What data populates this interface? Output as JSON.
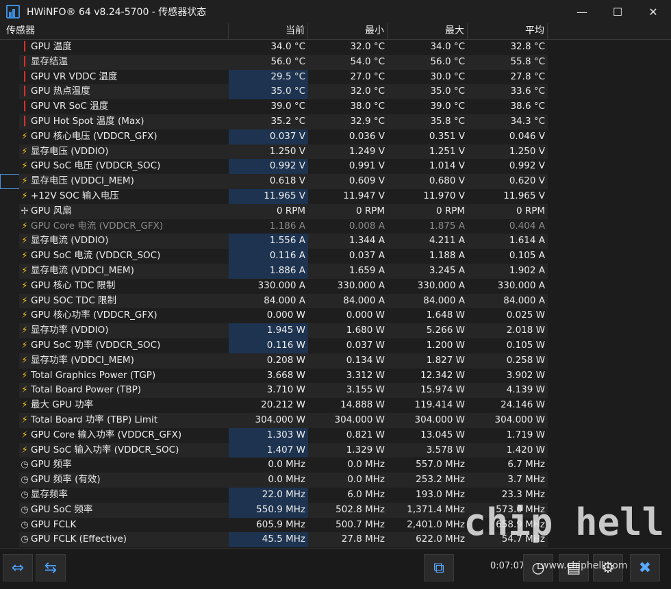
{
  "window": {
    "title": "HWiNFO® 64 v8.24-5700 - 传感器状态",
    "minimize": "—",
    "maximize": "☐",
    "close": "✕"
  },
  "columns": {
    "sensor": "传感器",
    "current": "当前",
    "min": "最小",
    "max": "最大",
    "avg": "平均"
  },
  "rows": [
    {
      "icon": "temp",
      "name": "GPU 温度",
      "cur": "34.0 °C",
      "min": "32.0 °C",
      "max": "34.0 °C",
      "avg": "32.8 °C"
    },
    {
      "icon": "temp",
      "name": "显存结温",
      "cur": "56.0 °C",
      "min": "54.0 °C",
      "max": "56.0 °C",
      "avg": "55.8 °C"
    },
    {
      "icon": "temp",
      "name": "GPU VR VDDC 温度",
      "cur": "29.5 °C",
      "min": "27.0 °C",
      "max": "30.0 °C",
      "avg": "27.8 °C",
      "hl": true
    },
    {
      "icon": "temp",
      "name": "GPU 热点温度",
      "cur": "35.0 °C",
      "min": "32.0 °C",
      "max": "35.0 °C",
      "avg": "33.6 °C",
      "hl": true
    },
    {
      "icon": "temp",
      "name": "GPU VR SoC 温度",
      "cur": "39.0 °C",
      "min": "38.0 °C",
      "max": "39.0 °C",
      "avg": "38.6 °C"
    },
    {
      "icon": "temp",
      "name": "GPU Hot Spot 温度 (Max)",
      "cur": "35.2 °C",
      "min": "32.9 °C",
      "max": "35.8 °C",
      "avg": "34.3 °C"
    },
    {
      "icon": "volt",
      "name": "GPU 核心电压 (VDDCR_GFX)",
      "cur": "0.037 V",
      "min": "0.036 V",
      "max": "0.351 V",
      "avg": "0.046 V",
      "hl": true
    },
    {
      "icon": "volt",
      "name": "显存电压 (VDDIO)",
      "cur": "1.250 V",
      "min": "1.249 V",
      "max": "1.251 V",
      "avg": "1.250 V"
    },
    {
      "icon": "volt",
      "name": "GPU SoC 电压 (VDDCR_SOC)",
      "cur": "0.992 V",
      "min": "0.991 V",
      "max": "1.014 V",
      "avg": "0.992 V",
      "hl": true
    },
    {
      "icon": "volt",
      "name": "显存电压 (VDDCI_MEM)",
      "cur": "0.618 V",
      "min": "0.609 V",
      "max": "0.680 V",
      "avg": "0.620 V",
      "sel": true
    },
    {
      "icon": "volt",
      "name": "+12V SOC 输入电压",
      "cur": "11.965 V",
      "min": "11.947 V",
      "max": "11.970 V",
      "avg": "11.965 V",
      "hl": true
    },
    {
      "icon": "fan",
      "name": "GPU 风扇",
      "cur": "0 RPM",
      "min": "0 RPM",
      "max": "0 RPM",
      "avg": "0 RPM"
    },
    {
      "icon": "volt",
      "name": "GPU Core 电流 (VDDCR_GFX)",
      "cur": "1.186 A",
      "min": "0.008 A",
      "max": "1.875 A",
      "avg": "0.404 A",
      "dim": true
    },
    {
      "icon": "volt",
      "name": "显存电流 (VDDIO)",
      "cur": "1.556 A",
      "min": "1.344 A",
      "max": "4.211 A",
      "avg": "1.614 A",
      "hl": true
    },
    {
      "icon": "volt",
      "name": "GPU SoC 电流 (VDDCR_SOC)",
      "cur": "0.116 A",
      "min": "0.037 A",
      "max": "1.188 A",
      "avg": "0.105 A",
      "hl": true
    },
    {
      "icon": "volt",
      "name": "显存电流 (VDDCI_MEM)",
      "cur": "1.886 A",
      "min": "1.659 A",
      "max": "3.245 A",
      "avg": "1.902 A",
      "hl": true
    },
    {
      "icon": "volt",
      "name": "GPU 核心 TDC 限制",
      "cur": "330.000 A",
      "min": "330.000 A",
      "max": "330.000 A",
      "avg": "330.000 A"
    },
    {
      "icon": "volt",
      "name": "GPU SOC TDC 限制",
      "cur": "84.000 A",
      "min": "84.000 A",
      "max": "84.000 A",
      "avg": "84.000 A"
    },
    {
      "icon": "volt",
      "name": "GPU 核心功率 (VDDCR_GFX)",
      "cur": "0.000 W",
      "min": "0.000 W",
      "max": "1.648 W",
      "avg": "0.025 W"
    },
    {
      "icon": "volt",
      "name": "显存功率 (VDDIO)",
      "cur": "1.945 W",
      "min": "1.680 W",
      "max": "5.266 W",
      "avg": "2.018 W",
      "hl": true
    },
    {
      "icon": "volt",
      "name": "GPU SoC 功率 (VDDCR_SOC)",
      "cur": "0.116 W",
      "min": "0.037 W",
      "max": "1.200 W",
      "avg": "0.105 W",
      "hl": true
    },
    {
      "icon": "volt",
      "name": "显存功率 (VDDCI_MEM)",
      "cur": "0.208 W",
      "min": "0.134 W",
      "max": "1.827 W",
      "avg": "0.258 W"
    },
    {
      "icon": "volt",
      "name": "Total Graphics Power (TGP)",
      "cur": "3.668 W",
      "min": "3.312 W",
      "max": "12.342 W",
      "avg": "3.902 W"
    },
    {
      "icon": "volt",
      "name": "Total Board Power (TBP)",
      "cur": "3.710 W",
      "min": "3.155 W",
      "max": "15.974 W",
      "avg": "4.139 W"
    },
    {
      "icon": "volt",
      "name": "最大 GPU 功率",
      "cur": "20.212 W",
      "min": "14.888 W",
      "max": "119.414 W",
      "avg": "24.146 W"
    },
    {
      "icon": "volt",
      "name": "Total Board 功率 (TBP) Limit",
      "cur": "304.000 W",
      "min": "304.000 W",
      "max": "304.000 W",
      "avg": "304.000 W"
    },
    {
      "icon": "volt",
      "name": "GPU Core 输入功率 (VDDCR_GFX)",
      "cur": "1.303 W",
      "min": "0.821 W",
      "max": "13.045 W",
      "avg": "1.719 W",
      "hl": true
    },
    {
      "icon": "volt",
      "name": "GPU SoC 输入功率 (VDDCR_SOC)",
      "cur": "1.407 W",
      "min": "1.329 W",
      "max": "3.578 W",
      "avg": "1.420 W",
      "hl": true
    },
    {
      "icon": "clock",
      "name": "GPU 频率",
      "cur": "0.0 MHz",
      "min": "0.0 MHz",
      "max": "557.0 MHz",
      "avg": "6.7 MHz"
    },
    {
      "icon": "clock",
      "name": "GPU 频率 (有效)",
      "cur": "0.0 MHz",
      "min": "0.0 MHz",
      "max": "253.2 MHz",
      "avg": "3.7 MHz"
    },
    {
      "icon": "clock",
      "name": "显存频率",
      "cur": "22.0 MHz",
      "min": "6.0 MHz",
      "max": "193.0 MHz",
      "avg": "23.3 MHz",
      "hl": true
    },
    {
      "icon": "clock",
      "name": "GPU SoC 频率",
      "cur": "550.9 MHz",
      "min": "502.8 MHz",
      "max": "1,371.4 MHz",
      "avg": "573.0 MHz",
      "hl": true
    },
    {
      "icon": "clock",
      "name": "GPU FCLK",
      "cur": "605.9 MHz",
      "min": "500.7 MHz",
      "max": "2,401.0 MHz",
      "avg": "658.9 MHz"
    },
    {
      "icon": "clock",
      "name": "GPU FCLK (Effective)",
      "cur": "45.5 MHz",
      "min": "27.8 MHz",
      "max": "622.0 MHz",
      "avg": "54.7 MHz",
      "hl": true
    }
  ],
  "icons": {
    "temp": "thermometer-icon",
    "volt": "lightning-icon",
    "fan": "fan-icon",
    "clock": "clock-icon"
  },
  "footer": {
    "timer": "0:07:07",
    "watermark": "chip hell",
    "watermark_url": "www.chiphell.com"
  }
}
